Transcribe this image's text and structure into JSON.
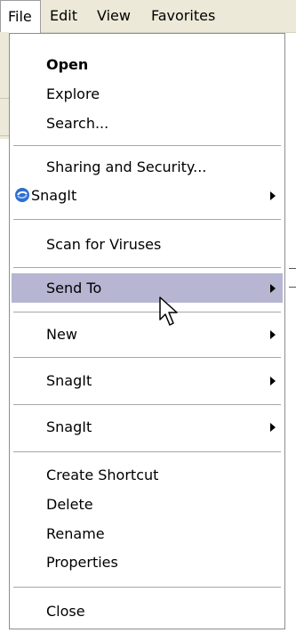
{
  "menubar": {
    "items": [
      {
        "label": "File",
        "active": true
      },
      {
        "label": "Edit",
        "active": false
      },
      {
        "label": "View",
        "active": false
      },
      {
        "label": "Favorites",
        "active": false
      }
    ]
  },
  "file_menu": {
    "open": "Open",
    "explore": "Explore",
    "search": "Search...",
    "sharing": "Sharing and Security...",
    "snagit_top": "SnagIt",
    "scan": "Scan for Viruses",
    "send_to": "Send To",
    "new": "New",
    "snagit_2": "SnagIt",
    "snagit_3": "SnagIt",
    "create_shortcut": "Create Shortcut",
    "delete": "Delete",
    "rename": "Rename",
    "properties": "Properties",
    "close": "Close"
  },
  "colors": {
    "menubar_bg": "#ece9d8",
    "highlight": "#b6b5d2",
    "snagit_icon": "#2f6fd0"
  },
  "icons": {
    "snagit": "snagit-icon",
    "submenu": "submenu-arrow-icon",
    "cursor": "mouse-pointer-icon"
  }
}
